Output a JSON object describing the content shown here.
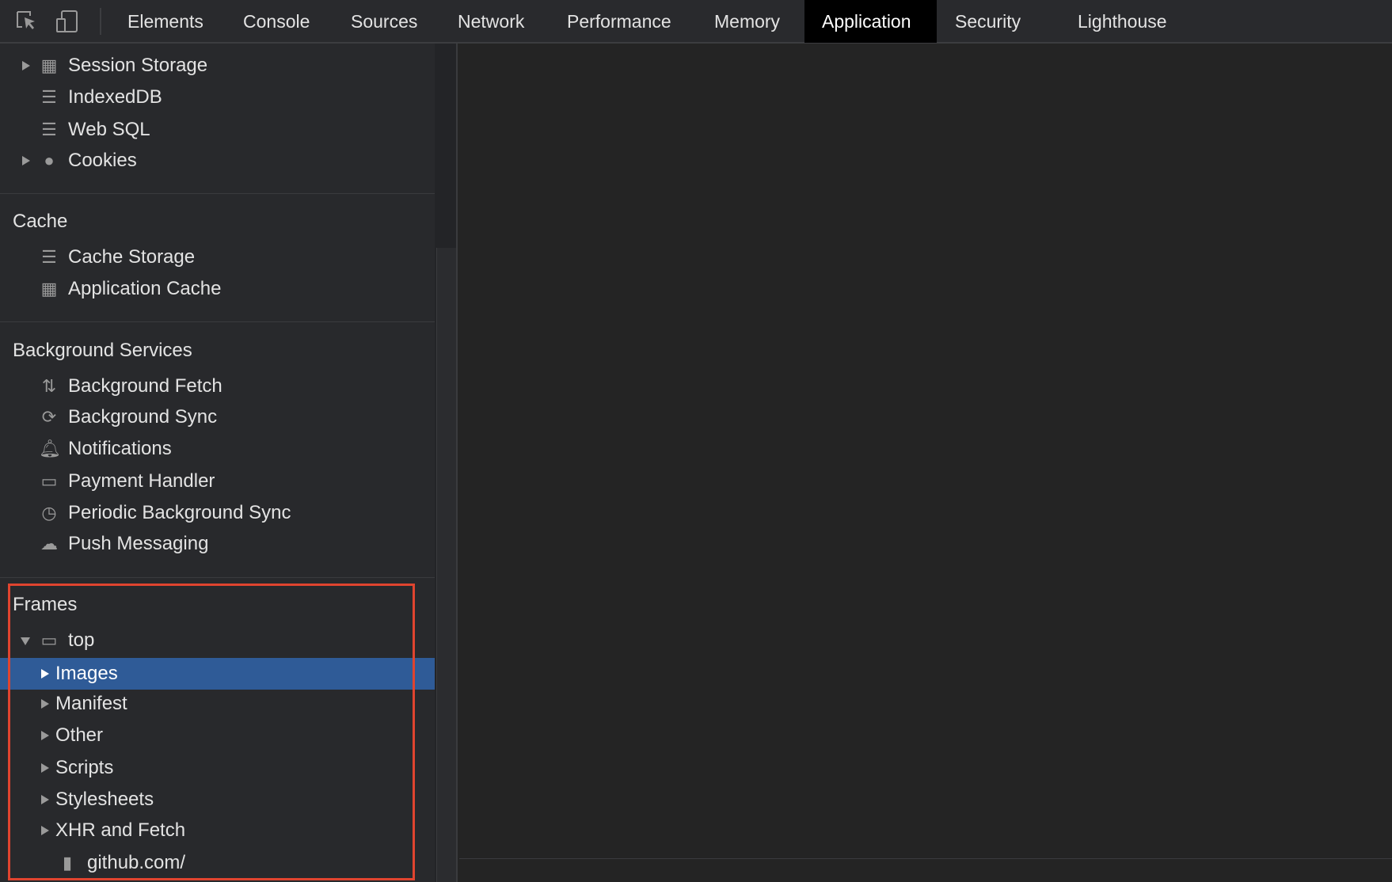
{
  "tabs": [
    "Elements",
    "Console",
    "Sources",
    "Network",
    "Performance",
    "Memory",
    "Application",
    "Security",
    "Lighthouse"
  ],
  "active_tab": "Application",
  "storage_items": [
    {
      "label": "Session Storage",
      "icon": "table-icon"
    },
    {
      "label": "IndexedDB",
      "icon": "database-icon"
    },
    {
      "label": "Web SQL",
      "icon": "database-icon"
    },
    {
      "label": "Cookies",
      "icon": "cookie-icon"
    }
  ],
  "cache": {
    "title": "Cache",
    "items": [
      {
        "label": "Cache Storage",
        "icon": "database-icon"
      },
      {
        "label": "Application Cache",
        "icon": "table-icon"
      }
    ]
  },
  "background": {
    "title": "Background Services",
    "items": [
      {
        "label": "Background Fetch",
        "icon": "up-down-arrows-icon"
      },
      {
        "label": "Background Sync",
        "icon": "sync-icon"
      },
      {
        "label": "Notifications",
        "icon": "bell-icon"
      },
      {
        "label": "Payment Handler",
        "icon": "credit-card-icon"
      },
      {
        "label": "Periodic Background Sync",
        "icon": "clock-icon"
      },
      {
        "label": "Push Messaging",
        "icon": "cloud-icon"
      }
    ]
  },
  "frames": {
    "title": "Frames",
    "top": "top",
    "children": [
      "Images",
      "Manifest",
      "Other",
      "Scripts",
      "Stylesheets",
      "XHR and Fetch"
    ],
    "selected": "Images",
    "file": "github.com/"
  },
  "colors": {
    "selected": "#2f5b97",
    "highlight_box": "#e0442f"
  }
}
